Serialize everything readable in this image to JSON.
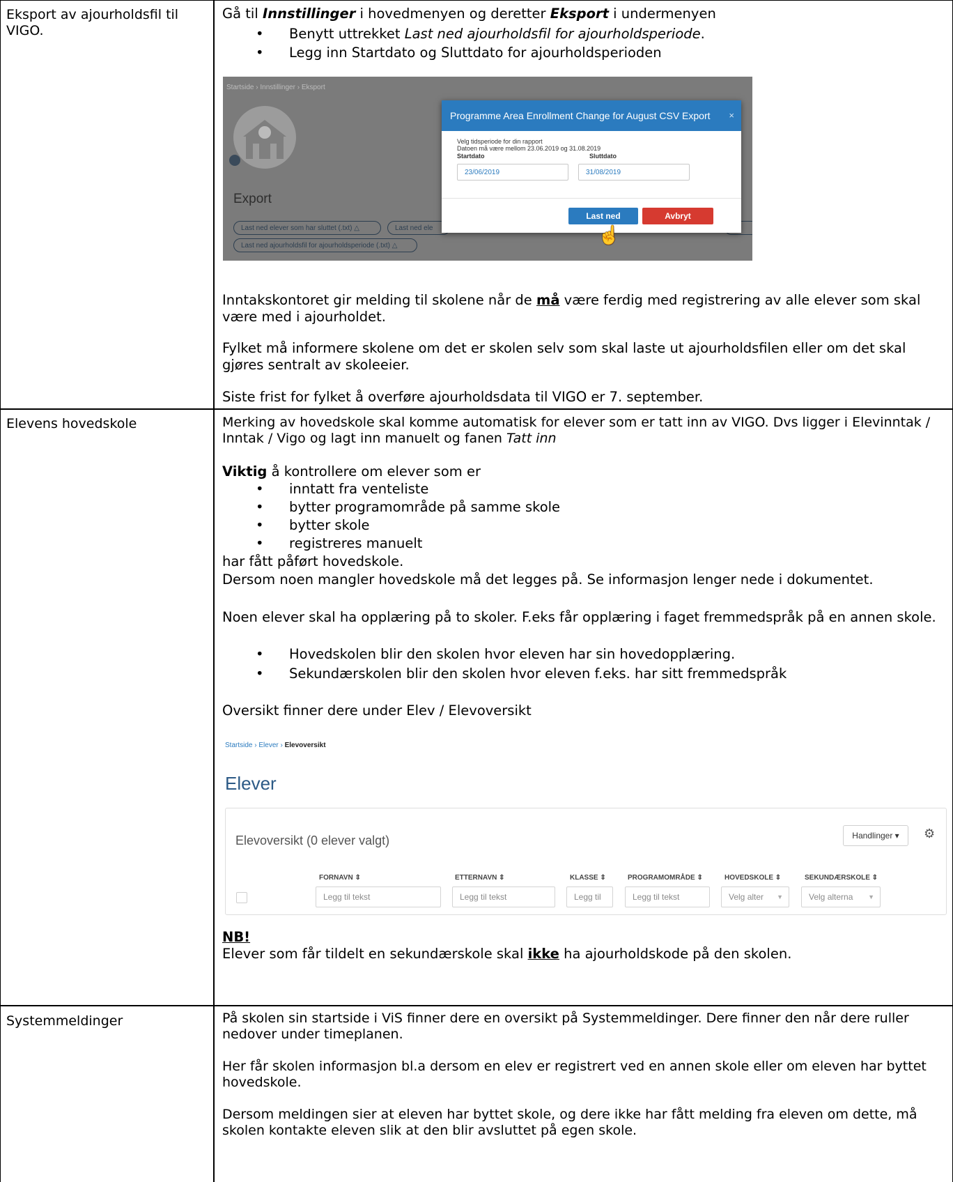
{
  "rows": [
    {
      "label": "Eksport av ajourholdsfil til VIGO.",
      "p1_prefix": "Gå til ",
      "p1_b1": "Innstillinger",
      "p1_mid": " i hovedmenyen og deretter ",
      "p1_b2": "Eksport",
      "p1_suffix": " i undermenyen",
      "bullets": [
        {
          "pre": "Benytt uttrekket ",
          "em": "Last ned ajourholdsfil for ajourholdsperiode",
          "post": "."
        },
        {
          "pre": "Legg inn Startdato og Sluttdato for ajourholdsperioden",
          "em": "",
          "post": ""
        }
      ],
      "screenshot": {
        "breadcrumb": "Startside  ›  Innstillinger  ›  Eksport",
        "export_heading": "Export",
        "pill_1": "Last ned elever som har sluttet (.txt) △",
        "pill_2": "Last ned ele",
        "pill_3": "Last ned ajourholdsfil for ajourholdsperiode (.txt) △",
        "pill_4": "t n",
        "dialog_title": "Programme Area Enrollment Change for August CSV Export",
        "dialog_close": "×",
        "help_1": "Velg tidsperiode for din rapport",
        "help_2": "Datoen må være mellom 23.06.2019 og 31.08.2019",
        "start_label": "Startdato",
        "start_value": "23/06/2019",
        "end_label": "Sluttdato",
        "end_value": "31/08/2019",
        "download_button": "Last ned",
        "cancel_button": "Avbryt"
      },
      "p2_pre": "Inntakskontoret gir melding til skolene når de ",
      "p2_bu": "må",
      "p2_post": " være ferdig med registrering av alle elever som skal være med i ajourholdet.",
      "p3": "Fylket må informere skolene om det er skolen selv som skal laste ut ajourholdsfilen eller om det skal gjøres sentralt av skoleeier.",
      "p4": "Siste frist for fylket å overføre ajourholdsdata til VIGO er 7. september."
    },
    {
      "label": "Elevens hovedskole",
      "p1_pre": "Merking av hovedskole skal komme automatisk for elever som er tatt inn av VIGO. Dvs ligger i Elevinntak / Inntak / Vigo og lagt inn manuelt og fanen ",
      "p1_em": "Tatt inn",
      "p2_b": "Viktig",
      "p2_rest": " å kontrollere om elever som er",
      "check_bullets": [
        "inntatt fra venteliste",
        "bytter programområde på samme skole",
        "bytter skole",
        "registreres manuelt"
      ],
      "p3": "har fått påført hovedskole.",
      "p4": "Dersom noen mangler hovedskole må det legges på. Se informasjon lenger nede i dokumentet.",
      "p5": "Noen elever skal ha opplæring på to skoler. F.eks får opplæring i faget fremmedspråk på en annen skole.",
      "school_bullets": [
        "Hovedskolen blir den skolen hvor eleven har sin hovedopplæring.",
        "Sekundærskolen blir den skolen hvor eleven f.eks. har sitt fremmedspråk"
      ],
      "p6": "Oversikt finner dere under Elev / Elevoversikt",
      "screenshot": {
        "crumb_1": "Startside",
        "crumb_sep": " › ",
        "crumb_2": "Elever",
        "crumb_3": "Elevoversikt",
        "title": "Elever",
        "panel_title": "Elevoversikt (0 elever valgt)",
        "actions_button": "Handlinger ▾",
        "gear": "⚙",
        "col_fornavn": "FORNAVN ⇕",
        "col_etternavn": "ETTERNAVN ⇕",
        "col_klasse": "KLASSE ⇕",
        "col_programomrade": "PROGRAMOMRÅDE ⇕",
        "col_hovedskole": "HOVEDSKOLE ⇕",
        "col_sekundarskole": "SEKUNDÆRSKOLE ⇕",
        "ph_fornavn": "Legg til tekst",
        "ph_etternavn": "Legg til tekst",
        "ph_klasse": "Legg til",
        "ph_programomrade": "Legg til tekst",
        "ph_hovedskole": "Velg alter",
        "ph_sekundarskole": "Velg alterna"
      },
      "nb_heading": "NB!",
      "nb_pre": "Elever som får tildelt en sekundærskole skal ",
      "nb_bu": "ikke",
      "nb_post": " ha ajourholdskode på den skolen."
    },
    {
      "label": "Systemmeldinger",
      "p1": "På skolen sin startside i ViS finner dere en oversikt på Systemmeldinger. Dere finner den når dere ruller nedover under timeplanen.",
      "p2": "Her får skolen informasjon bl.a dersom en elev er registrert ved en annen skole eller om eleven har byttet hovedskole.",
      "p3": "Dersom meldingen sier at eleven har byttet skole, og dere ikke har fått melding fra eleven om dette, må skolen kontakte eleven slik at den blir avsluttet på egen skole."
    }
  ]
}
